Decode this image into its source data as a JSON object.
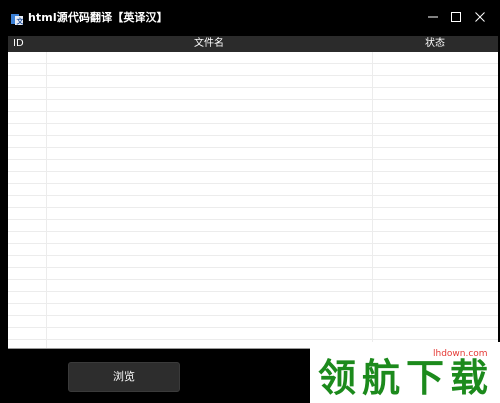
{
  "window": {
    "title": "html源代码翻译【英译汉】"
  },
  "table": {
    "columns": [
      "ID",
      "文件名",
      "状态"
    ],
    "rows": []
  },
  "footer": {
    "browse_label": "浏览"
  },
  "watermark": {
    "url": "lhdown.com",
    "text": "领航下载"
  },
  "colors": {
    "background": "#000000",
    "header": "#2b2b2b",
    "grid_line": "#ececec",
    "button": "#2d2d2d",
    "watermark_green": "#1c8a1c",
    "watermark_red": "#e53935"
  }
}
